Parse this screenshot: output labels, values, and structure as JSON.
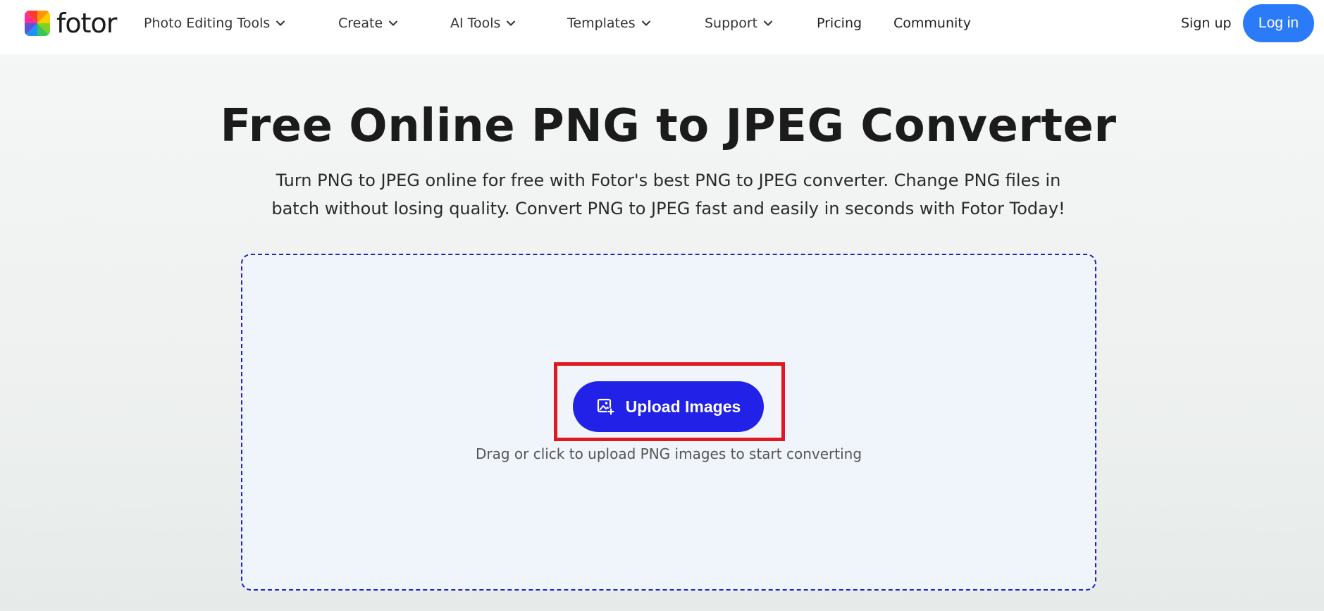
{
  "brand": {
    "name": "fotor"
  },
  "nav": {
    "items": [
      {
        "label": "Photo Editing Tools",
        "has_dropdown": true
      },
      {
        "label": "Create",
        "has_dropdown": true
      },
      {
        "label": "AI Tools",
        "has_dropdown": true
      },
      {
        "label": "Templates",
        "has_dropdown": true
      },
      {
        "label": "Support",
        "has_dropdown": true
      },
      {
        "label": "Pricing",
        "has_dropdown": false
      },
      {
        "label": "Community",
        "has_dropdown": false
      }
    ],
    "signup_label": "Sign up",
    "login_label": "Log in"
  },
  "hero": {
    "title": "Free Online PNG to JPEG Converter",
    "subtitle_line1": "Turn PNG to JPEG online for free with Fotor's best PNG to JPEG converter. Change PNG files in",
    "subtitle_line2": "batch without losing quality. Convert PNG to JPEG fast and easily in seconds with Fotor Today!"
  },
  "upload": {
    "button_label": "Upload Images",
    "hint": "Drag or click to upload PNG images to start converting"
  },
  "colors": {
    "login_bg": "#2b7af8",
    "upload_bg": "#2121e8",
    "dropzone_border": "#2222c8",
    "highlight": "#e0181f"
  },
  "icons": {
    "logo": "fotor-logo-icon",
    "dropdown": "chevron-down-icon",
    "upload": "image-add-icon"
  }
}
